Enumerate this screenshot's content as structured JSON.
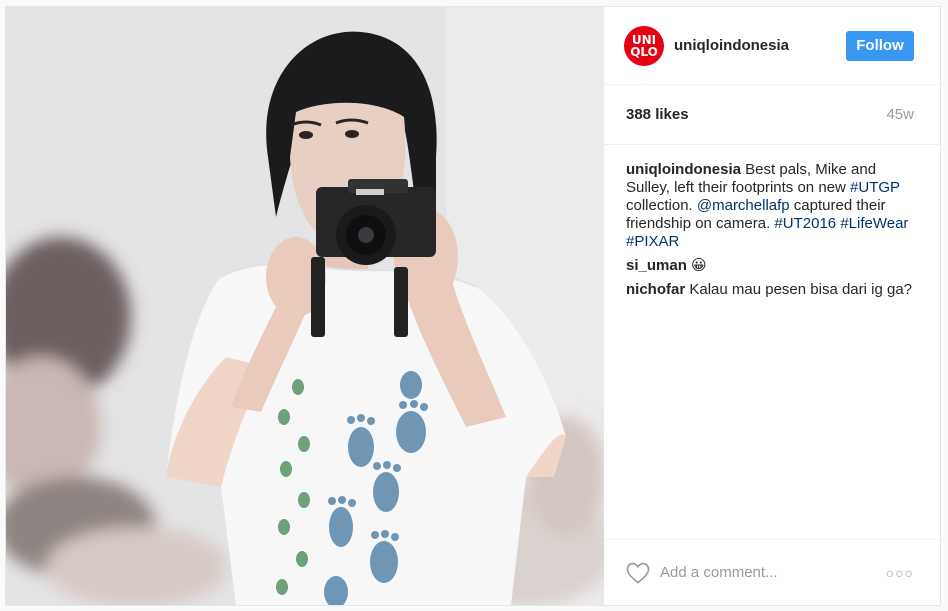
{
  "post": {
    "image_alt": "Woman in a white t-shirt with blue footprints taking a photo with a camera",
    "account": {
      "username": "uniqloindonesia",
      "logo_lines": [
        "UNI",
        "QLO"
      ],
      "logo_color": "#e60012"
    },
    "follow_label": "Follow",
    "likes": "388 likes",
    "age": "45w",
    "caption": {
      "user": "uniqloindonesia",
      "text_1": "Best pals, Mike and Sulley, left their footprints on new ",
      "tag_utgp": "#UTGP",
      "text_2": " collection. ",
      "mention": "@marchellafp",
      "text_3": " captured their friendship on camera. ",
      "tag_ut2016": "#UT2016",
      "tag_lifewear": "#LifeWear",
      "tag_pixar": "#PIXAR"
    },
    "comments": [
      {
        "user": "si_uman",
        "text": "😀"
      },
      {
        "user": "nichofar",
        "text": "Kalau mau pesen bisa dari ig ga?"
      }
    ],
    "add_comment_placeholder": "Add a comment...",
    "more_label": "○○○",
    "colors": {
      "follow": "#3897f0",
      "link": "#003569"
    }
  }
}
